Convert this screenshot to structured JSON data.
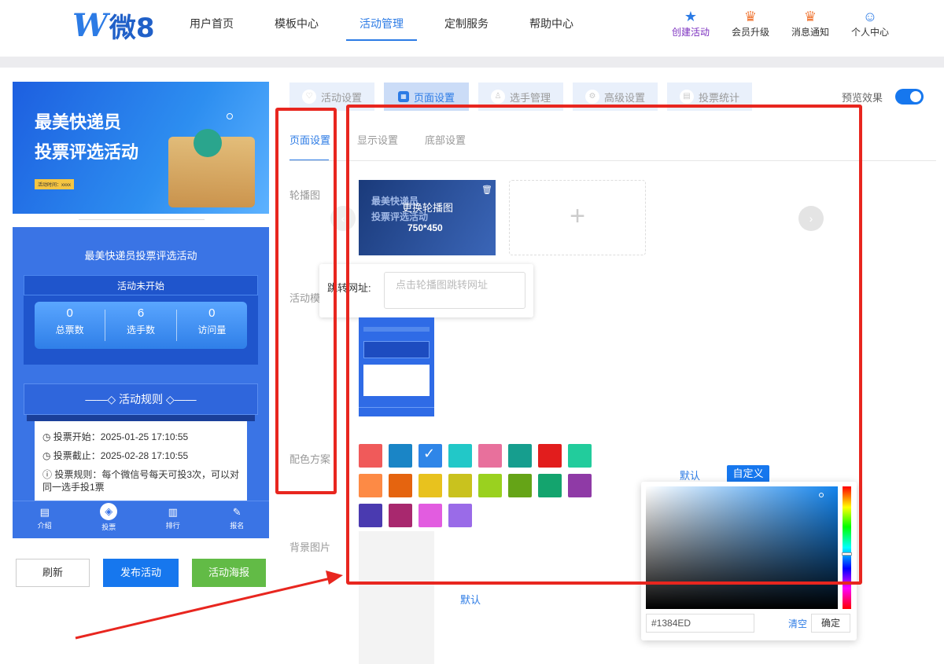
{
  "logo": {
    "text_w": "W",
    "text_rest": "微8"
  },
  "nav": [
    {
      "label": "用户首页",
      "active": false
    },
    {
      "label": "模板中心",
      "active": false
    },
    {
      "label": "活动管理",
      "active": true
    },
    {
      "label": "定制服务",
      "active": false
    },
    {
      "label": "帮助中心",
      "active": false
    }
  ],
  "tools": [
    {
      "label": "创建活动",
      "icon": "star-icon"
    },
    {
      "label": "会员升级",
      "icon": "crown-icon"
    },
    {
      "label": "消息通知",
      "icon": "bell-icon"
    },
    {
      "label": "个人中心",
      "icon": "user-icon"
    }
  ],
  "banner": {
    "line1": "最美快递员",
    "line2": "投票评选活动",
    "tag": "活动时间：xxxx"
  },
  "phone": {
    "title": "最美快递员投票评选活动",
    "status": "活动未开始",
    "stats": [
      {
        "value": "0",
        "label": "总票数"
      },
      {
        "value": "6",
        "label": "选手数"
      },
      {
        "value": "0",
        "label": "访问量"
      }
    ],
    "rules_header": "——◇ 活动规则 ◇——",
    "rules": [
      "◷ 投票开始：2025-01-25 17:10:55",
      "◷ 投票截止：2025-02-28 17:10:55",
      "ⓘ 投票规则：每个微信号每天可投3次，可以对同一选手投1票"
    ],
    "tabs": [
      {
        "label": "介绍",
        "icon": "doc-icon"
      },
      {
        "label": "投票",
        "icon": "vote-icon"
      },
      {
        "label": "排行",
        "icon": "chart-icon"
      },
      {
        "label": "报名",
        "icon": "edit-icon"
      }
    ]
  },
  "buttons": {
    "refresh": "刷新",
    "publish": "发布活动",
    "poster": "活动海报"
  },
  "top_tabs": [
    {
      "label": "活动设置",
      "active": false
    },
    {
      "label": "页面设置",
      "active": true
    },
    {
      "label": "选手管理",
      "active": false
    },
    {
      "label": "高级设置",
      "active": false
    },
    {
      "label": "投票统计",
      "active": false
    }
  ],
  "preview_label": "预览效果",
  "sub_tabs": [
    {
      "label": "页面设置",
      "active": true
    },
    {
      "label": "显示设置",
      "active": false
    },
    {
      "label": "底部设置",
      "active": false
    }
  ],
  "fields": {
    "carousel": "轮播图",
    "template": "活动模",
    "color": "配色方案",
    "background": "背景图片"
  },
  "carousel": {
    "overlay_text": "更换轮播图",
    "size": "750*450",
    "img_line1": "最美快递员",
    "img_line2": "投票评选活动",
    "add": "+"
  },
  "jump": {
    "label": "跳转网址:",
    "placeholder": "点击轮播图跳转网址"
  },
  "palette": [
    "#f05a5a",
    "#1a85c6",
    "#2f86e8",
    "#22c8c8",
    "#e8709c",
    "#169e8e",
    "#e21d1d",
    "#22cc9c",
    "#fd8a45",
    "#e5640f",
    "#e8c21e",
    "#c9c21e",
    "#9ad11f",
    "#65a417",
    "#14a46e",
    "#8f3aa6",
    "#4a3ab0",
    "#a8286e",
    "#e25ce0",
    "#9a6be8"
  ],
  "palette_selected": 2,
  "color_options": {
    "default": "默认",
    "custom": "自定义"
  },
  "background_default": "默认",
  "picker": {
    "hex": "#1384ED",
    "clear": "清空",
    "ok": "确定"
  }
}
